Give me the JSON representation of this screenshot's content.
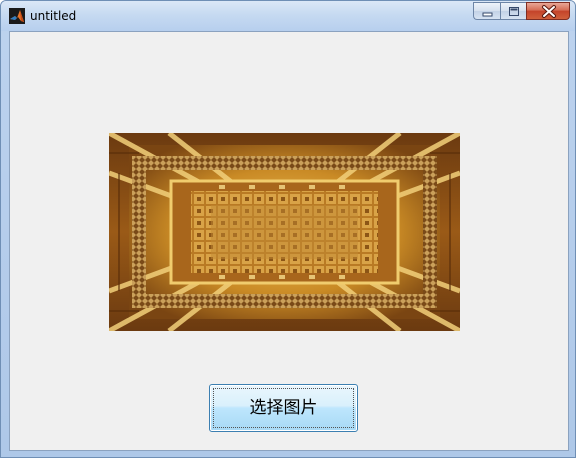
{
  "window": {
    "title": "untitled",
    "app_icon": "matlab-logo-icon",
    "caption_icons": {
      "minimize": "minimize-icon",
      "maximize": "maximize-icon",
      "close": "close-icon"
    }
  },
  "main": {
    "image": {
      "subject": "ceiling-view-photo"
    },
    "select_button_label": "选择图片"
  }
}
